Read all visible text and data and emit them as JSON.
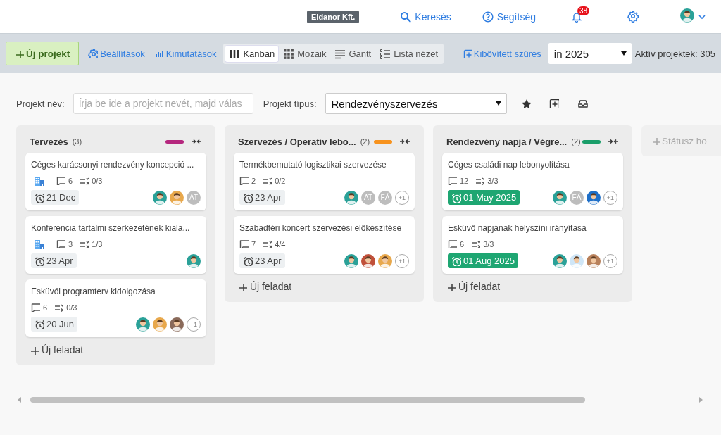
{
  "header": {
    "company": "Eldanor Kft.",
    "search": "Keresés",
    "help": "Segítség",
    "notifications": "38"
  },
  "toolbar": {
    "new_project": "Új projekt",
    "settings": "Beállítások",
    "reports": "Kimutatások",
    "views": [
      {
        "kind": "kanban",
        "label": "Kanban",
        "selected": true
      },
      {
        "kind": "grid",
        "label": "Mozaik",
        "selected": false
      },
      {
        "kind": "gantt",
        "label": "Gantt",
        "selected": false
      },
      {
        "kind": "list",
        "label": "Lista nézet",
        "selected": false
      }
    ],
    "advanced_filter": "Kibővített szűrés",
    "year": "in 2025",
    "active_projects": "Aktív projektek: 305"
  },
  "filters": {
    "name_label": "Projekt név:",
    "name_placeholder": "Írja be ide a projekt nevét, majd válas",
    "type_label": "Projekt típus:",
    "type_value": "Rendezvényszervezés"
  },
  "columns": [
    {
      "title": "Tervezés",
      "count": "(3)",
      "color": "#b5277e",
      "add_label": "Új feladat",
      "cards": [
        {
          "title": "Céges karácsonyi rendezvény koncepció ...",
          "company": true,
          "comments": "6",
          "checklist": "0/3",
          "due": "21 Dec",
          "done": false,
          "avatars": [
            {
              "kind": "photo",
              "color": "#2aa198"
            },
            {
              "kind": "photo",
              "color": "#e8a84c"
            },
            {
              "kind": "initials",
              "text": "AT"
            }
          ]
        },
        {
          "title": "Konferencia tartalmi szerkezetének kiala...",
          "company": true,
          "comments": "3",
          "checklist": "1/3",
          "due": "23 Apr",
          "done": false,
          "avatars": [
            {
              "kind": "photo",
              "color": "#2aa198"
            }
          ]
        },
        {
          "title": "Esküvői programterv kidolgozása",
          "company": false,
          "comments": "6",
          "checklist": "0/3",
          "due": "20 Jun",
          "done": false,
          "avatars": [
            {
              "kind": "photo",
              "color": "#2aa198"
            },
            {
              "kind": "photo",
              "color": "#e8a84c"
            },
            {
              "kind": "photo",
              "color": "#8a6a5a"
            },
            {
              "kind": "more",
              "text": "+1"
            }
          ]
        }
      ]
    },
    {
      "title": "Szervezés / Operatív lebo...",
      "count": "(2)",
      "color": "#f7931e",
      "add_label": "Új feladat",
      "cards": [
        {
          "title": "Termékbemutató logisztikai szervezése",
          "company": false,
          "comments": "2",
          "checklist": "0/2",
          "due": "23 Apr",
          "done": false,
          "avatars": [
            {
              "kind": "photo",
              "color": "#2aa198"
            },
            {
              "kind": "initials",
              "text": "AT"
            },
            {
              "kind": "initials",
              "text": "FÁ"
            },
            {
              "kind": "more",
              "text": "+1"
            }
          ]
        },
        {
          "title": "Szabadtéri koncert szervezési előkészítése",
          "company": false,
          "comments": "7",
          "checklist": "4/4",
          "due": "23 Apr",
          "done": false,
          "avatars": [
            {
              "kind": "photo",
              "color": "#2aa198"
            },
            {
              "kind": "photo",
              "color": "#c0503a"
            },
            {
              "kind": "photo",
              "color": "#e8a84c"
            },
            {
              "kind": "more",
              "text": "+1"
            }
          ]
        }
      ]
    },
    {
      "title": "Rendezvény napja / Végre...",
      "count": "(2)",
      "color": "#1a9e6a",
      "add_label": "Új feladat",
      "cards": [
        {
          "title": "Céges családi nap lebonyolítása",
          "company": false,
          "comments": "12",
          "checklist": "3/3",
          "due": "01 May 2025",
          "done": true,
          "avatars": [
            {
              "kind": "photo",
              "color": "#2aa198"
            },
            {
              "kind": "initials",
              "text": "FÁ"
            },
            {
              "kind": "photo",
              "color": "#1e6fc8"
            },
            {
              "kind": "more",
              "text": "+1"
            }
          ]
        },
        {
          "title": "Esküvő napjának helyszíni irányítása",
          "company": false,
          "comments": "6",
          "checklist": "3/3",
          "due": "01 Aug 2025",
          "done": true,
          "avatars": [
            {
              "kind": "photo",
              "color": "#2aa198"
            },
            {
              "kind": "photo",
              "color": "#cfe6f7"
            },
            {
              "kind": "photo",
              "color": "#b8805a"
            },
            {
              "kind": "more",
              "text": "+1"
            }
          ]
        }
      ]
    }
  ],
  "add_status": "Státusz ho"
}
